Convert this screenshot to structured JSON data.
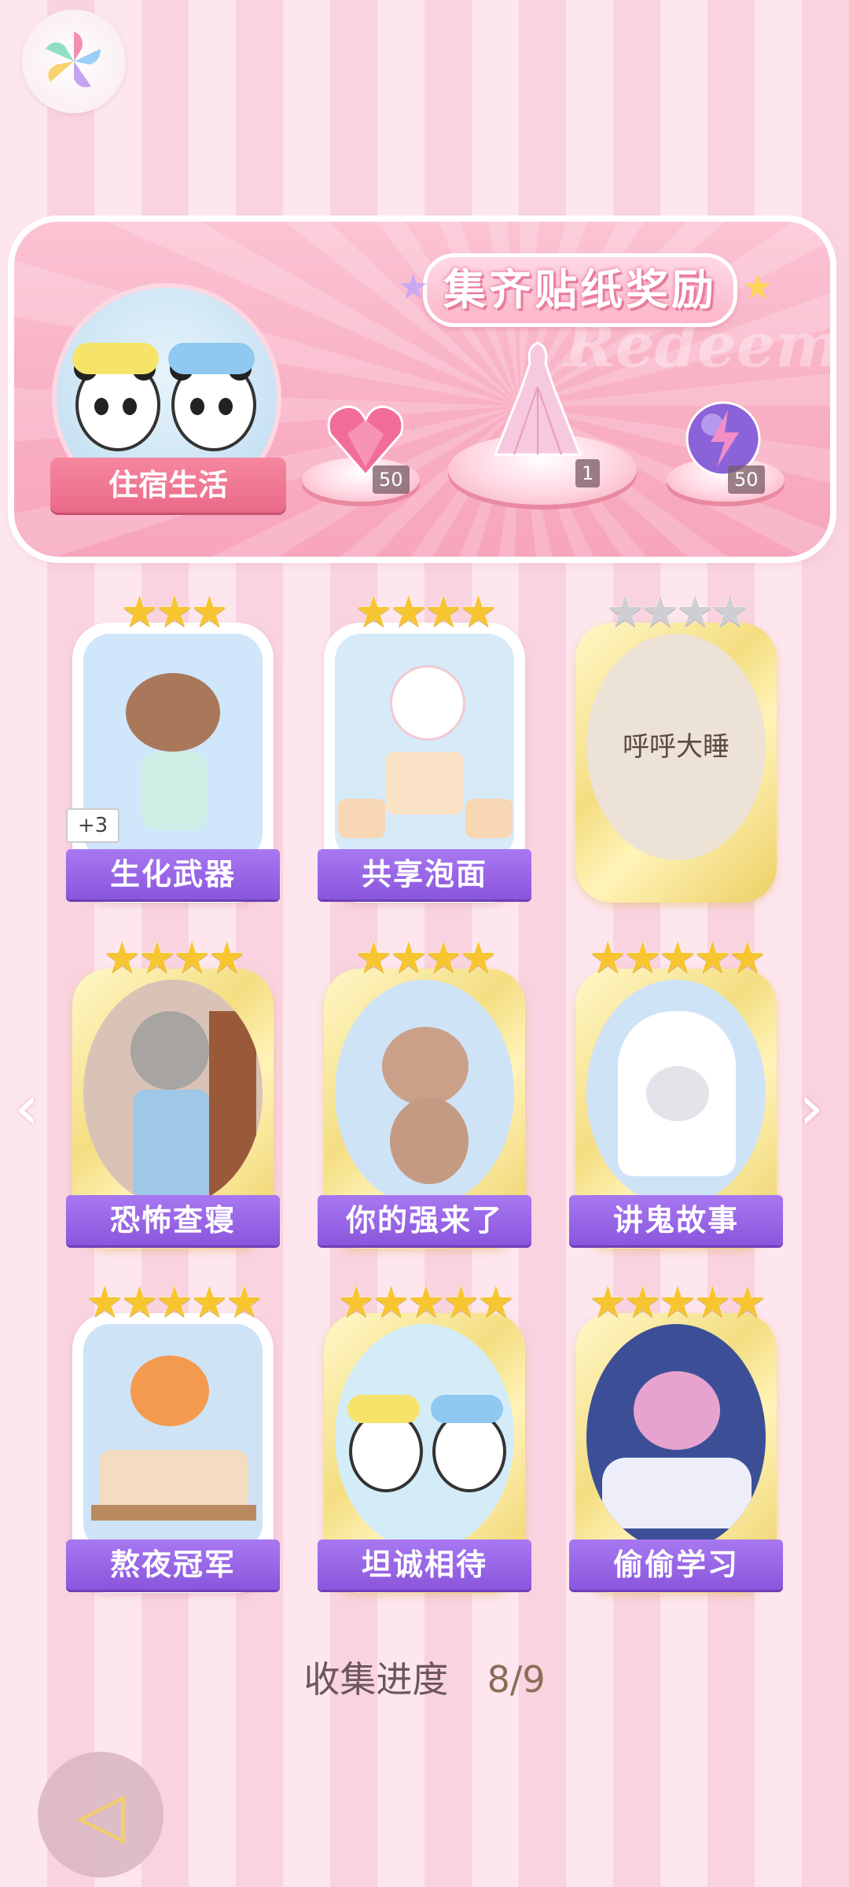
{
  "banner": {
    "title": "集齐贴纸奖励",
    "watermark": "Redeem",
    "album_label": "住宿生活",
    "rewards": [
      {
        "icon": "heart-gem-icon",
        "count": "50"
      },
      {
        "icon": "dress-outfit-icon",
        "count": "1"
      },
      {
        "icon": "energy-orb-icon",
        "count": "50"
      }
    ]
  },
  "stickers": [
    {
      "label": "生化武器",
      "stars": 3,
      "collected": true,
      "badge": "+3"
    },
    {
      "label": "共享泡面",
      "stars": 4,
      "collected": true
    },
    {
      "label": "呼呼大睡",
      "stars": 4,
      "collected": false
    },
    {
      "label": "恐怖查寝",
      "stars": 4,
      "collected": true
    },
    {
      "label": "你的强来了",
      "stars": 4,
      "collected": true
    },
    {
      "label": "讲鬼故事",
      "stars": 5,
      "collected": true
    },
    {
      "label": "熬夜冠军",
      "stars": 5,
      "collected": true
    },
    {
      "label": "坦诚相待",
      "stars": 5,
      "collected": true
    },
    {
      "label": "偷偷学习",
      "stars": 5,
      "collected": true
    }
  ],
  "progress": {
    "label": "收集进度",
    "value": "8/9"
  },
  "colors": {
    "accent_purple": "#8a56dc",
    "banner_pink": "#f8aec3",
    "star_gold": "#f7c52f"
  }
}
